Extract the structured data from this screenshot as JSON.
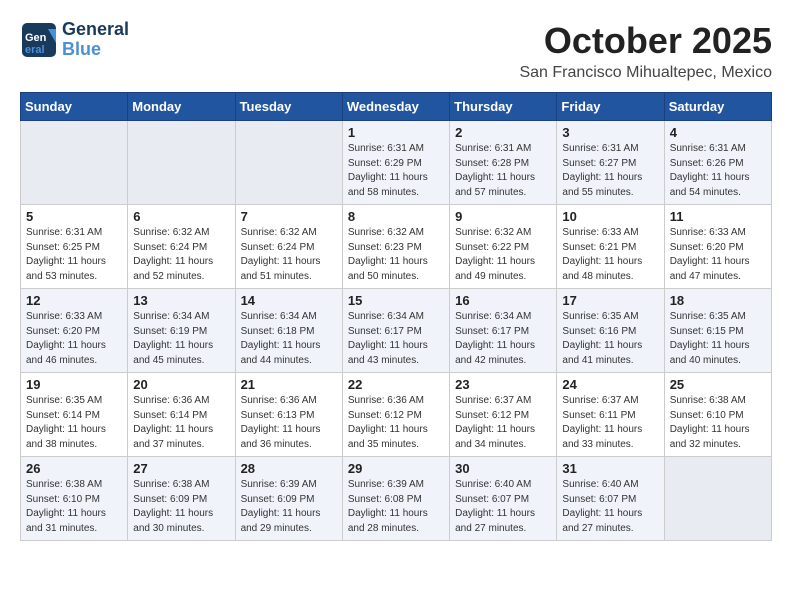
{
  "header": {
    "logo_line1": "General",
    "logo_line2": "Blue",
    "month": "October 2025",
    "location": "San Francisco Mihualtepec, Mexico"
  },
  "weekdays": [
    "Sunday",
    "Monday",
    "Tuesday",
    "Wednesday",
    "Thursday",
    "Friday",
    "Saturday"
  ],
  "weeks": [
    [
      {
        "day": "",
        "info": ""
      },
      {
        "day": "",
        "info": ""
      },
      {
        "day": "",
        "info": ""
      },
      {
        "day": "1",
        "info": "Sunrise: 6:31 AM\nSunset: 6:29 PM\nDaylight: 11 hours\nand 58 minutes."
      },
      {
        "day": "2",
        "info": "Sunrise: 6:31 AM\nSunset: 6:28 PM\nDaylight: 11 hours\nand 57 minutes."
      },
      {
        "day": "3",
        "info": "Sunrise: 6:31 AM\nSunset: 6:27 PM\nDaylight: 11 hours\nand 55 minutes."
      },
      {
        "day": "4",
        "info": "Sunrise: 6:31 AM\nSunset: 6:26 PM\nDaylight: 11 hours\nand 54 minutes."
      }
    ],
    [
      {
        "day": "5",
        "info": "Sunrise: 6:31 AM\nSunset: 6:25 PM\nDaylight: 11 hours\nand 53 minutes."
      },
      {
        "day": "6",
        "info": "Sunrise: 6:32 AM\nSunset: 6:24 PM\nDaylight: 11 hours\nand 52 minutes."
      },
      {
        "day": "7",
        "info": "Sunrise: 6:32 AM\nSunset: 6:24 PM\nDaylight: 11 hours\nand 51 minutes."
      },
      {
        "day": "8",
        "info": "Sunrise: 6:32 AM\nSunset: 6:23 PM\nDaylight: 11 hours\nand 50 minutes."
      },
      {
        "day": "9",
        "info": "Sunrise: 6:32 AM\nSunset: 6:22 PM\nDaylight: 11 hours\nand 49 minutes."
      },
      {
        "day": "10",
        "info": "Sunrise: 6:33 AM\nSunset: 6:21 PM\nDaylight: 11 hours\nand 48 minutes."
      },
      {
        "day": "11",
        "info": "Sunrise: 6:33 AM\nSunset: 6:20 PM\nDaylight: 11 hours\nand 47 minutes."
      }
    ],
    [
      {
        "day": "12",
        "info": "Sunrise: 6:33 AM\nSunset: 6:20 PM\nDaylight: 11 hours\nand 46 minutes."
      },
      {
        "day": "13",
        "info": "Sunrise: 6:34 AM\nSunset: 6:19 PM\nDaylight: 11 hours\nand 45 minutes."
      },
      {
        "day": "14",
        "info": "Sunrise: 6:34 AM\nSunset: 6:18 PM\nDaylight: 11 hours\nand 44 minutes."
      },
      {
        "day": "15",
        "info": "Sunrise: 6:34 AM\nSunset: 6:17 PM\nDaylight: 11 hours\nand 43 minutes."
      },
      {
        "day": "16",
        "info": "Sunrise: 6:34 AM\nSunset: 6:17 PM\nDaylight: 11 hours\nand 42 minutes."
      },
      {
        "day": "17",
        "info": "Sunrise: 6:35 AM\nSunset: 6:16 PM\nDaylight: 11 hours\nand 41 minutes."
      },
      {
        "day": "18",
        "info": "Sunrise: 6:35 AM\nSunset: 6:15 PM\nDaylight: 11 hours\nand 40 minutes."
      }
    ],
    [
      {
        "day": "19",
        "info": "Sunrise: 6:35 AM\nSunset: 6:14 PM\nDaylight: 11 hours\nand 38 minutes."
      },
      {
        "day": "20",
        "info": "Sunrise: 6:36 AM\nSunset: 6:14 PM\nDaylight: 11 hours\nand 37 minutes."
      },
      {
        "day": "21",
        "info": "Sunrise: 6:36 AM\nSunset: 6:13 PM\nDaylight: 11 hours\nand 36 minutes."
      },
      {
        "day": "22",
        "info": "Sunrise: 6:36 AM\nSunset: 6:12 PM\nDaylight: 11 hours\nand 35 minutes."
      },
      {
        "day": "23",
        "info": "Sunrise: 6:37 AM\nSunset: 6:12 PM\nDaylight: 11 hours\nand 34 minutes."
      },
      {
        "day": "24",
        "info": "Sunrise: 6:37 AM\nSunset: 6:11 PM\nDaylight: 11 hours\nand 33 minutes."
      },
      {
        "day": "25",
        "info": "Sunrise: 6:38 AM\nSunset: 6:10 PM\nDaylight: 11 hours\nand 32 minutes."
      }
    ],
    [
      {
        "day": "26",
        "info": "Sunrise: 6:38 AM\nSunset: 6:10 PM\nDaylight: 11 hours\nand 31 minutes."
      },
      {
        "day": "27",
        "info": "Sunrise: 6:38 AM\nSunset: 6:09 PM\nDaylight: 11 hours\nand 30 minutes."
      },
      {
        "day": "28",
        "info": "Sunrise: 6:39 AM\nSunset: 6:09 PM\nDaylight: 11 hours\nand 29 minutes."
      },
      {
        "day": "29",
        "info": "Sunrise: 6:39 AM\nSunset: 6:08 PM\nDaylight: 11 hours\nand 28 minutes."
      },
      {
        "day": "30",
        "info": "Sunrise: 6:40 AM\nSunset: 6:07 PM\nDaylight: 11 hours\nand 27 minutes."
      },
      {
        "day": "31",
        "info": "Sunrise: 6:40 AM\nSunset: 6:07 PM\nDaylight: 11 hours\nand 27 minutes."
      },
      {
        "day": "",
        "info": ""
      }
    ]
  ]
}
